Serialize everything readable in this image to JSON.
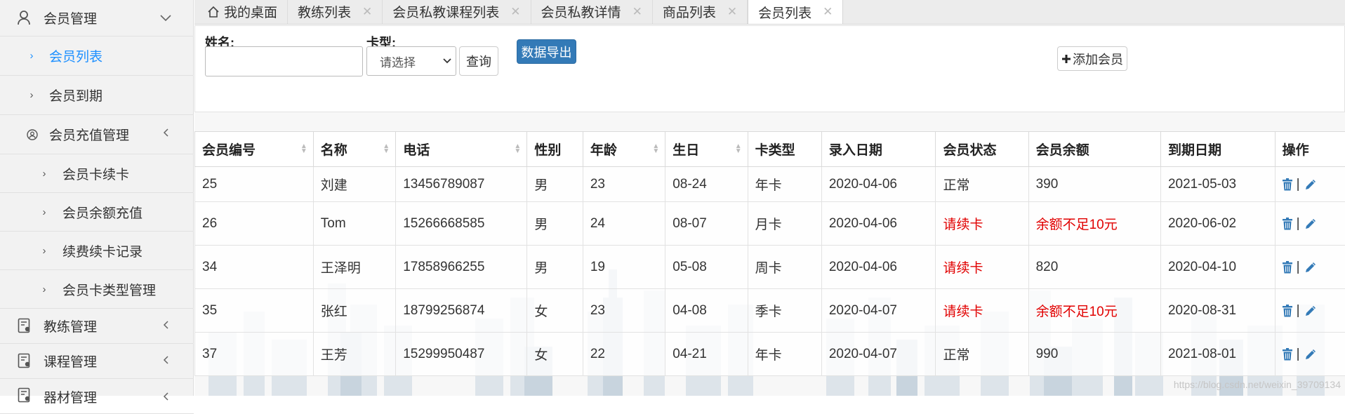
{
  "sidebar": {
    "items": [
      {
        "label": "会员管理",
        "icon": "user-icon",
        "arrow": "chevron-down-icon"
      },
      {
        "label": "会员列表",
        "active": true
      },
      {
        "label": "会员到期"
      },
      {
        "label": "会员充值管理",
        "icon": "user-circle-icon",
        "arrow": "chevron-left-icon"
      },
      {
        "label": "会员卡续卡"
      },
      {
        "label": "会员余额充值"
      },
      {
        "label": "续费续卡记录"
      },
      {
        "label": "会员卡类型管理"
      },
      {
        "label": "教练管理",
        "icon": "id-card-icon",
        "arrow": "chevron-left-icon"
      },
      {
        "label": "课程管理",
        "icon": "id-card-icon",
        "arrow": "chevron-left-icon"
      },
      {
        "label": "器材管理",
        "icon": "id-card-icon",
        "arrow": "chevron-left-icon"
      }
    ]
  },
  "tabs": [
    {
      "label": "我的桌面",
      "icon": "home-icon"
    },
    {
      "label": "教练列表",
      "closable": true
    },
    {
      "label": "会员私教课程列表",
      "closable": true
    },
    {
      "label": "会员私教详情",
      "closable": true
    },
    {
      "label": "商品列表",
      "closable": true
    },
    {
      "label": "会员列表",
      "closable": true,
      "active": true
    }
  ],
  "filters": {
    "name_label": "姓名:",
    "name_value": "",
    "card_label": "卡型:",
    "card_selected": "请选择",
    "query_button": "查询",
    "export_button": "数据导出",
    "add_button": "添加会员"
  },
  "table": {
    "columns": [
      "会员编号",
      "名称",
      "电话",
      "性别",
      "年龄",
      "生日",
      "卡类型",
      "录入日期",
      "会员状态",
      "会员余额",
      "到期日期",
      "操作"
    ],
    "rows": [
      [
        "25",
        "刘建",
        "13456789087",
        "男",
        "23",
        "08-24",
        "年卡",
        "2020-04-06",
        "正常",
        "390",
        "2021-05-03"
      ],
      [
        "26",
        "Tom",
        "15266668585",
        "男",
        "24",
        "08-07",
        "月卡",
        "2020-04-06",
        "请续卡",
        "余额不足10元",
        "2020-06-02"
      ],
      [
        "34",
        "王泽明",
        "17858966255",
        "男",
        "19",
        "05-08",
        "周卡",
        "2020-04-06",
        "请续卡",
        "820",
        "2020-04-10"
      ],
      [
        "35",
        "张红",
        "18799256874",
        "女",
        "23",
        "04-08",
        "季卡",
        "2020-04-07",
        "请续卡",
        "余额不足10元",
        "2020-08-31"
      ],
      [
        "37",
        "王芳",
        "15299950487",
        "女",
        "22",
        "04-21",
        "年卡",
        "2020-04-07",
        "正常",
        "990",
        "2021-08-01"
      ]
    ],
    "operation_separator": "|",
    "warning_color": "#e10000"
  },
  "watermark": "https://blog.csdn.net/weixin_39709134",
  "colors": {
    "primary": "#337ab7",
    "active_link": "#1e90ff"
  }
}
